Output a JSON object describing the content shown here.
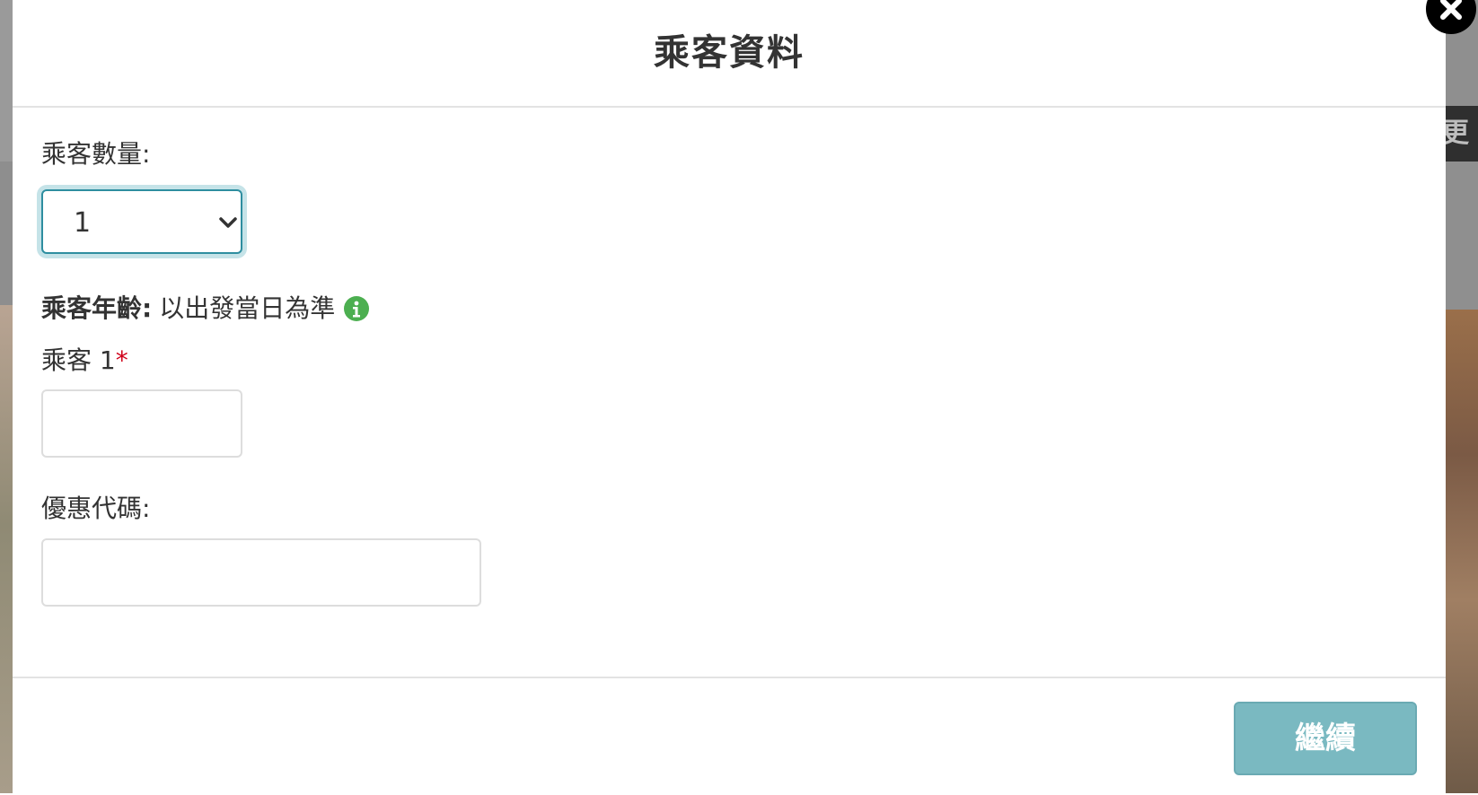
{
  "modal": {
    "title": "乘客資料"
  },
  "form": {
    "passenger_count_label": "乘客數量:",
    "passenger_count_value": "1",
    "age_label_bold": "乘客年齡:",
    "age_note": "以出發當日為準",
    "passenger_1_label": "乘客 1",
    "required_marker": "*",
    "passenger_1_value": "",
    "promo_label": "優惠代碼:",
    "promo_value": ""
  },
  "footer": {
    "continue_label": "繼續"
  },
  "background": {
    "right_tab_text": "更多"
  },
  "colors": {
    "accent": "#2e8ea0",
    "button": "#7ab9c1",
    "info_icon": "#4caf50",
    "required": "#d0021b"
  }
}
